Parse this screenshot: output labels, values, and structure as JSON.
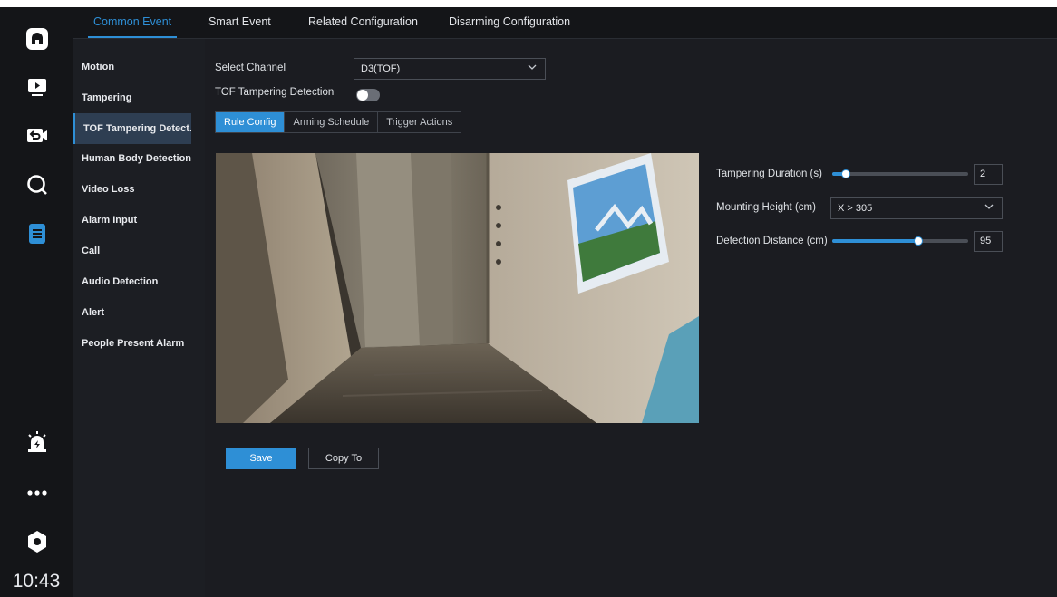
{
  "rail": {
    "icons": [
      "home-icon",
      "live-view-icon",
      "playback-icon",
      "search-icon",
      "event-config-icon",
      "alarm-icon",
      "more-icon",
      "settings-icon"
    ],
    "clock": "10:43"
  },
  "tabs": [
    {
      "label": "Common Event",
      "active": true
    },
    {
      "label": "Smart Event",
      "active": false
    },
    {
      "label": "Related Configuration",
      "active": false
    },
    {
      "label": "Disarming Configuration",
      "active": false
    }
  ],
  "submenu": [
    {
      "label": "Motion",
      "active": false
    },
    {
      "label": "Tampering",
      "active": false
    },
    {
      "label": "TOF Tampering Detect...",
      "active": true
    },
    {
      "label": "Human Body Detection",
      "active": false
    },
    {
      "label": "Video Loss",
      "active": false
    },
    {
      "label": "Alarm Input",
      "active": false
    },
    {
      "label": "Call",
      "active": false
    },
    {
      "label": "Audio Detection",
      "active": false
    },
    {
      "label": "Alert",
      "active": false
    },
    {
      "label": "People Present Alarm",
      "active": false
    }
  ],
  "form": {
    "channel_label": "Select Channel",
    "channel_value": "D3(TOF)",
    "detection_label": "TOF Tampering Detection",
    "detection_enabled": false
  },
  "subtabs": [
    {
      "label": "Rule Config",
      "active": true
    },
    {
      "label": "Arming Schedule",
      "active": false
    },
    {
      "label": "Trigger Actions",
      "active": false
    }
  ],
  "settings": {
    "duration_label": "Tampering Duration (s)",
    "duration_value": "2",
    "duration_fraction": 0.1,
    "height_label": "Mounting Height (cm)",
    "height_value": "X > 305",
    "distance_label": "Detection Distance (cm)",
    "distance_value": "95",
    "distance_fraction": 0.63
  },
  "actions": {
    "save_label": "Save",
    "copy_label": "Copy To"
  },
  "colors": {
    "accent": "#2e8fd6",
    "rail_bg": "#141518",
    "panel_bg": "#1b1c21"
  }
}
